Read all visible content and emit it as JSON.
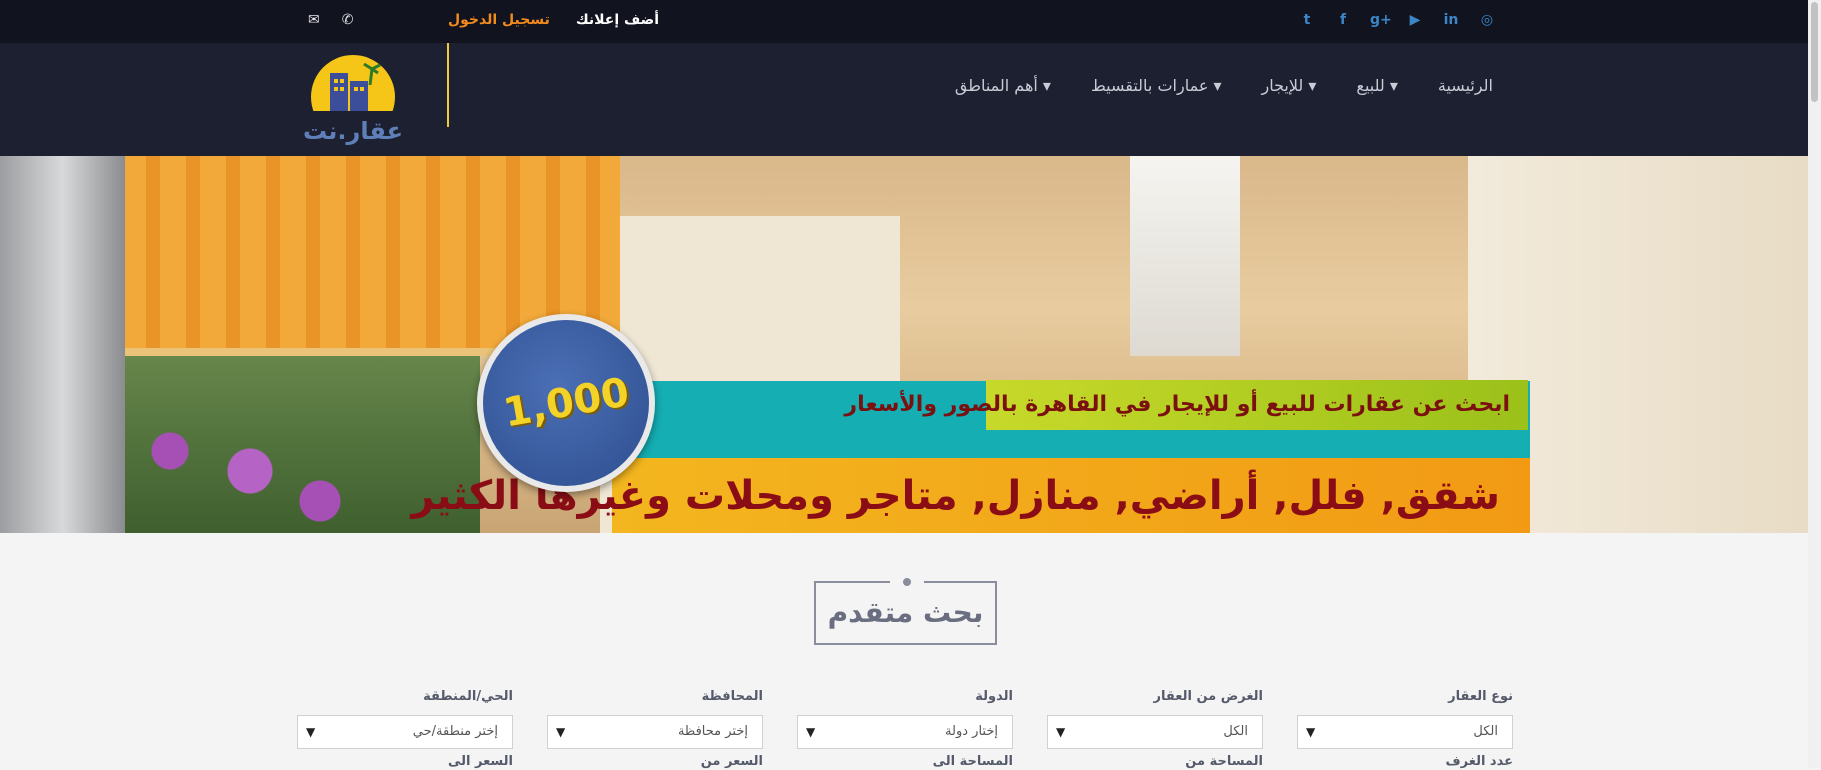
{
  "topbar": {
    "login": "تسجيل الدخول",
    "add_ad": "أضف إعلانك",
    "social_icons": [
      "instagram-icon",
      "linkedin-icon",
      "youtube-icon",
      "google-plus-icon",
      "facebook-icon",
      "twitter-icon"
    ],
    "contact_icons": [
      "phone-icon",
      "envelope-icon"
    ],
    "colors": {
      "background": "#11131f",
      "social": "#3b86c6",
      "login": "#f28a1c"
    }
  },
  "header": {
    "logo_text": "عقار.نت",
    "nav": [
      {
        "label": "الرئيسية"
      },
      {
        "label": "للبيع ▾"
      },
      {
        "label": "للإيجار ▾"
      },
      {
        "label": "عمارات بالتقسيط ▾"
      },
      {
        "label": "أهم المناطق ▾"
      }
    ]
  },
  "hero": {
    "badge": "1,000",
    "tagline": "ابحث عن عقارات للبيع أو للإيجار في القاهرة  بالصور والأسعار",
    "headline": "شقق, فلل, أراضي, منازل, متاجر ومحلات وغيرها الكثير"
  },
  "search": {
    "title": "بحث متقدم",
    "fields": [
      {
        "label": "نوع العقار",
        "value": "الكل"
      },
      {
        "label": "الغرض من العقار",
        "value": "الكل"
      },
      {
        "label": "الدولة",
        "value": "إختار دولة"
      },
      {
        "label": "المحافظة",
        "value": "إختر محافظة"
      },
      {
        "label": "الحي/المنطقة",
        "value": "إختر منطقة/حي"
      }
    ],
    "row2_labels": [
      "عدد الغرف",
      "المساحة من",
      "المساحة الى",
      "السعر من",
      "السعر الى"
    ]
  }
}
